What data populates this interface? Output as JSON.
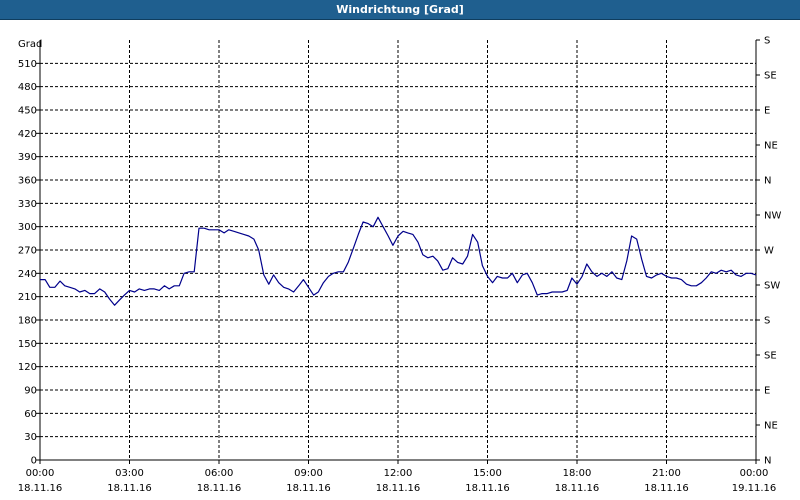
{
  "window": {
    "title": "Windrichtung [Grad]"
  },
  "chart_data": {
    "type": "line",
    "title": "Windrichtung [Grad]",
    "ylabel": "Grad",
    "xlabel": "",
    "ylim": [
      0,
      540
    ],
    "y_ticks": [
      0,
      30,
      60,
      90,
      120,
      150,
      180,
      210,
      240,
      270,
      300,
      330,
      360,
      390,
      420,
      450,
      480,
      510
    ],
    "y_right_ticks": [
      {
        "value": 0,
        "label": "N"
      },
      {
        "value": 45,
        "label": "NE"
      },
      {
        "value": 90,
        "label": "E"
      },
      {
        "value": 135,
        "label": "SE"
      },
      {
        "value": 180,
        "label": "S"
      },
      {
        "value": 225,
        "label": "SW"
      },
      {
        "value": 270,
        "label": "W"
      },
      {
        "value": 315,
        "label": "NW"
      },
      {
        "value": 360,
        "label": "N"
      },
      {
        "value": 405,
        "label": "NE"
      },
      {
        "value": 450,
        "label": "E"
      },
      {
        "value": 495,
        "label": "SE"
      },
      {
        "value": 540,
        "label": "S"
      }
    ],
    "xlim": [
      0,
      24
    ],
    "x_ticks": [
      {
        "value": 0,
        "time": "00:00",
        "date": "18.11.16"
      },
      {
        "value": 3,
        "time": "03:00",
        "date": "18.11.16"
      },
      {
        "value": 6,
        "time": "06:00",
        "date": "18.11.16"
      },
      {
        "value": 9,
        "time": "09:00",
        "date": "18.11.16"
      },
      {
        "value": 12,
        "time": "12:00",
        "date": "18.11.16"
      },
      {
        "value": 15,
        "time": "15:00",
        "date": "18.11.16"
      },
      {
        "value": 18,
        "time": "18:00",
        "date": "18.11.16"
      },
      {
        "value": 21,
        "time": "21:00",
        "date": "18.11.16"
      },
      {
        "value": 24,
        "time": "00:00",
        "date": "19.11.16"
      }
    ],
    "grid": true,
    "series": [
      {
        "color": "#00008b",
        "points": [
          [
            0.0,
            232
          ],
          [
            0.17,
            232
          ],
          [
            0.33,
            222
          ],
          [
            0.5,
            222
          ],
          [
            0.67,
            230
          ],
          [
            0.83,
            224
          ],
          [
            1.0,
            222
          ],
          [
            1.17,
            220
          ],
          [
            1.33,
            216
          ],
          [
            1.5,
            218
          ],
          [
            1.67,
            214
          ],
          [
            1.83,
            214
          ],
          [
            2.0,
            220
          ],
          [
            2.17,
            216
          ],
          [
            2.33,
            207
          ],
          [
            2.5,
            199
          ],
          [
            2.67,
            206
          ],
          [
            2.83,
            212
          ],
          [
            3.0,
            218
          ],
          [
            3.17,
            216
          ],
          [
            3.33,
            220
          ],
          [
            3.5,
            218
          ],
          [
            3.67,
            220
          ],
          [
            3.83,
            220
          ],
          [
            4.0,
            218
          ],
          [
            4.17,
            224
          ],
          [
            4.33,
            220
          ],
          [
            4.5,
            224
          ],
          [
            4.67,
            224
          ],
          [
            4.83,
            240
          ],
          [
            5.0,
            242
          ],
          [
            5.17,
            242
          ],
          [
            5.33,
            298
          ],
          [
            5.5,
            298
          ],
          [
            5.67,
            296
          ],
          [
            5.83,
            296
          ],
          [
            6.0,
            296
          ],
          [
            6.17,
            292
          ],
          [
            6.33,
            296
          ],
          [
            6.5,
            294
          ],
          [
            6.67,
            292
          ],
          [
            6.83,
            290
          ],
          [
            7.0,
            288
          ],
          [
            7.17,
            284
          ],
          [
            7.33,
            270
          ],
          [
            7.5,
            238
          ],
          [
            7.67,
            226
          ],
          [
            7.83,
            238
          ],
          [
            8.0,
            228
          ],
          [
            8.17,
            222
          ],
          [
            8.33,
            220
          ],
          [
            8.5,
            216
          ],
          [
            8.67,
            224
          ],
          [
            8.83,
            232
          ],
          [
            9.0,
            222
          ],
          [
            9.17,
            212
          ],
          [
            9.33,
            216
          ],
          [
            9.5,
            228
          ],
          [
            9.67,
            236
          ],
          [
            9.83,
            240
          ],
          [
            10.0,
            242
          ],
          [
            10.17,
            242
          ],
          [
            10.33,
            254
          ],
          [
            10.5,
            272
          ],
          [
            10.67,
            290
          ],
          [
            10.83,
            306
          ],
          [
            11.0,
            304
          ],
          [
            11.17,
            300
          ],
          [
            11.33,
            312
          ],
          [
            11.5,
            300
          ],
          [
            11.67,
            288
          ],
          [
            11.83,
            276
          ],
          [
            12.0,
            288
          ],
          [
            12.17,
            294
          ],
          [
            12.33,
            292
          ],
          [
            12.5,
            290
          ],
          [
            12.67,
            280
          ],
          [
            12.83,
            264
          ],
          [
            13.0,
            260
          ],
          [
            13.17,
            262
          ],
          [
            13.33,
            256
          ],
          [
            13.5,
            244
          ],
          [
            13.67,
            246
          ],
          [
            13.83,
            260
          ],
          [
            14.0,
            254
          ],
          [
            14.17,
            252
          ],
          [
            14.33,
            262
          ],
          [
            14.5,
            290
          ],
          [
            14.67,
            280
          ],
          [
            14.83,
            250
          ],
          [
            15.0,
            236
          ],
          [
            15.17,
            228
          ],
          [
            15.33,
            236
          ],
          [
            15.5,
            234
          ],
          [
            15.67,
            234
          ],
          [
            15.83,
            240
          ],
          [
            16.0,
            228
          ],
          [
            16.17,
            238
          ],
          [
            16.33,
            240
          ],
          [
            16.5,
            228
          ],
          [
            16.67,
            212
          ],
          [
            16.83,
            214
          ],
          [
            17.0,
            214
          ],
          [
            17.17,
            216
          ],
          [
            17.33,
            216
          ],
          [
            17.5,
            216
          ],
          [
            17.67,
            218
          ],
          [
            17.83,
            234
          ],
          [
            18.0,
            226
          ],
          [
            18.17,
            236
          ],
          [
            18.33,
            252
          ],
          [
            18.5,
            242
          ],
          [
            18.67,
            236
          ],
          [
            18.83,
            240
          ],
          [
            19.0,
            236
          ],
          [
            19.17,
            242
          ],
          [
            19.33,
            234
          ],
          [
            19.5,
            232
          ],
          [
            19.67,
            256
          ],
          [
            19.83,
            288
          ],
          [
            20.0,
            284
          ],
          [
            20.17,
            258
          ],
          [
            20.33,
            236
          ],
          [
            20.5,
            234
          ],
          [
            20.67,
            238
          ],
          [
            20.83,
            240
          ],
          [
            21.0,
            236
          ],
          [
            21.17,
            234
          ],
          [
            21.33,
            234
          ],
          [
            21.5,
            232
          ],
          [
            21.67,
            226
          ],
          [
            21.83,
            224
          ],
          [
            22.0,
            224
          ],
          [
            22.17,
            228
          ],
          [
            22.33,
            234
          ],
          [
            22.5,
            242
          ],
          [
            22.67,
            240
          ],
          [
            22.83,
            244
          ],
          [
            23.0,
            242
          ],
          [
            23.17,
            244
          ],
          [
            23.33,
            238
          ],
          [
            23.5,
            236
          ],
          [
            23.67,
            240
          ],
          [
            23.83,
            240
          ],
          [
            24.0,
            238
          ]
        ]
      }
    ]
  }
}
